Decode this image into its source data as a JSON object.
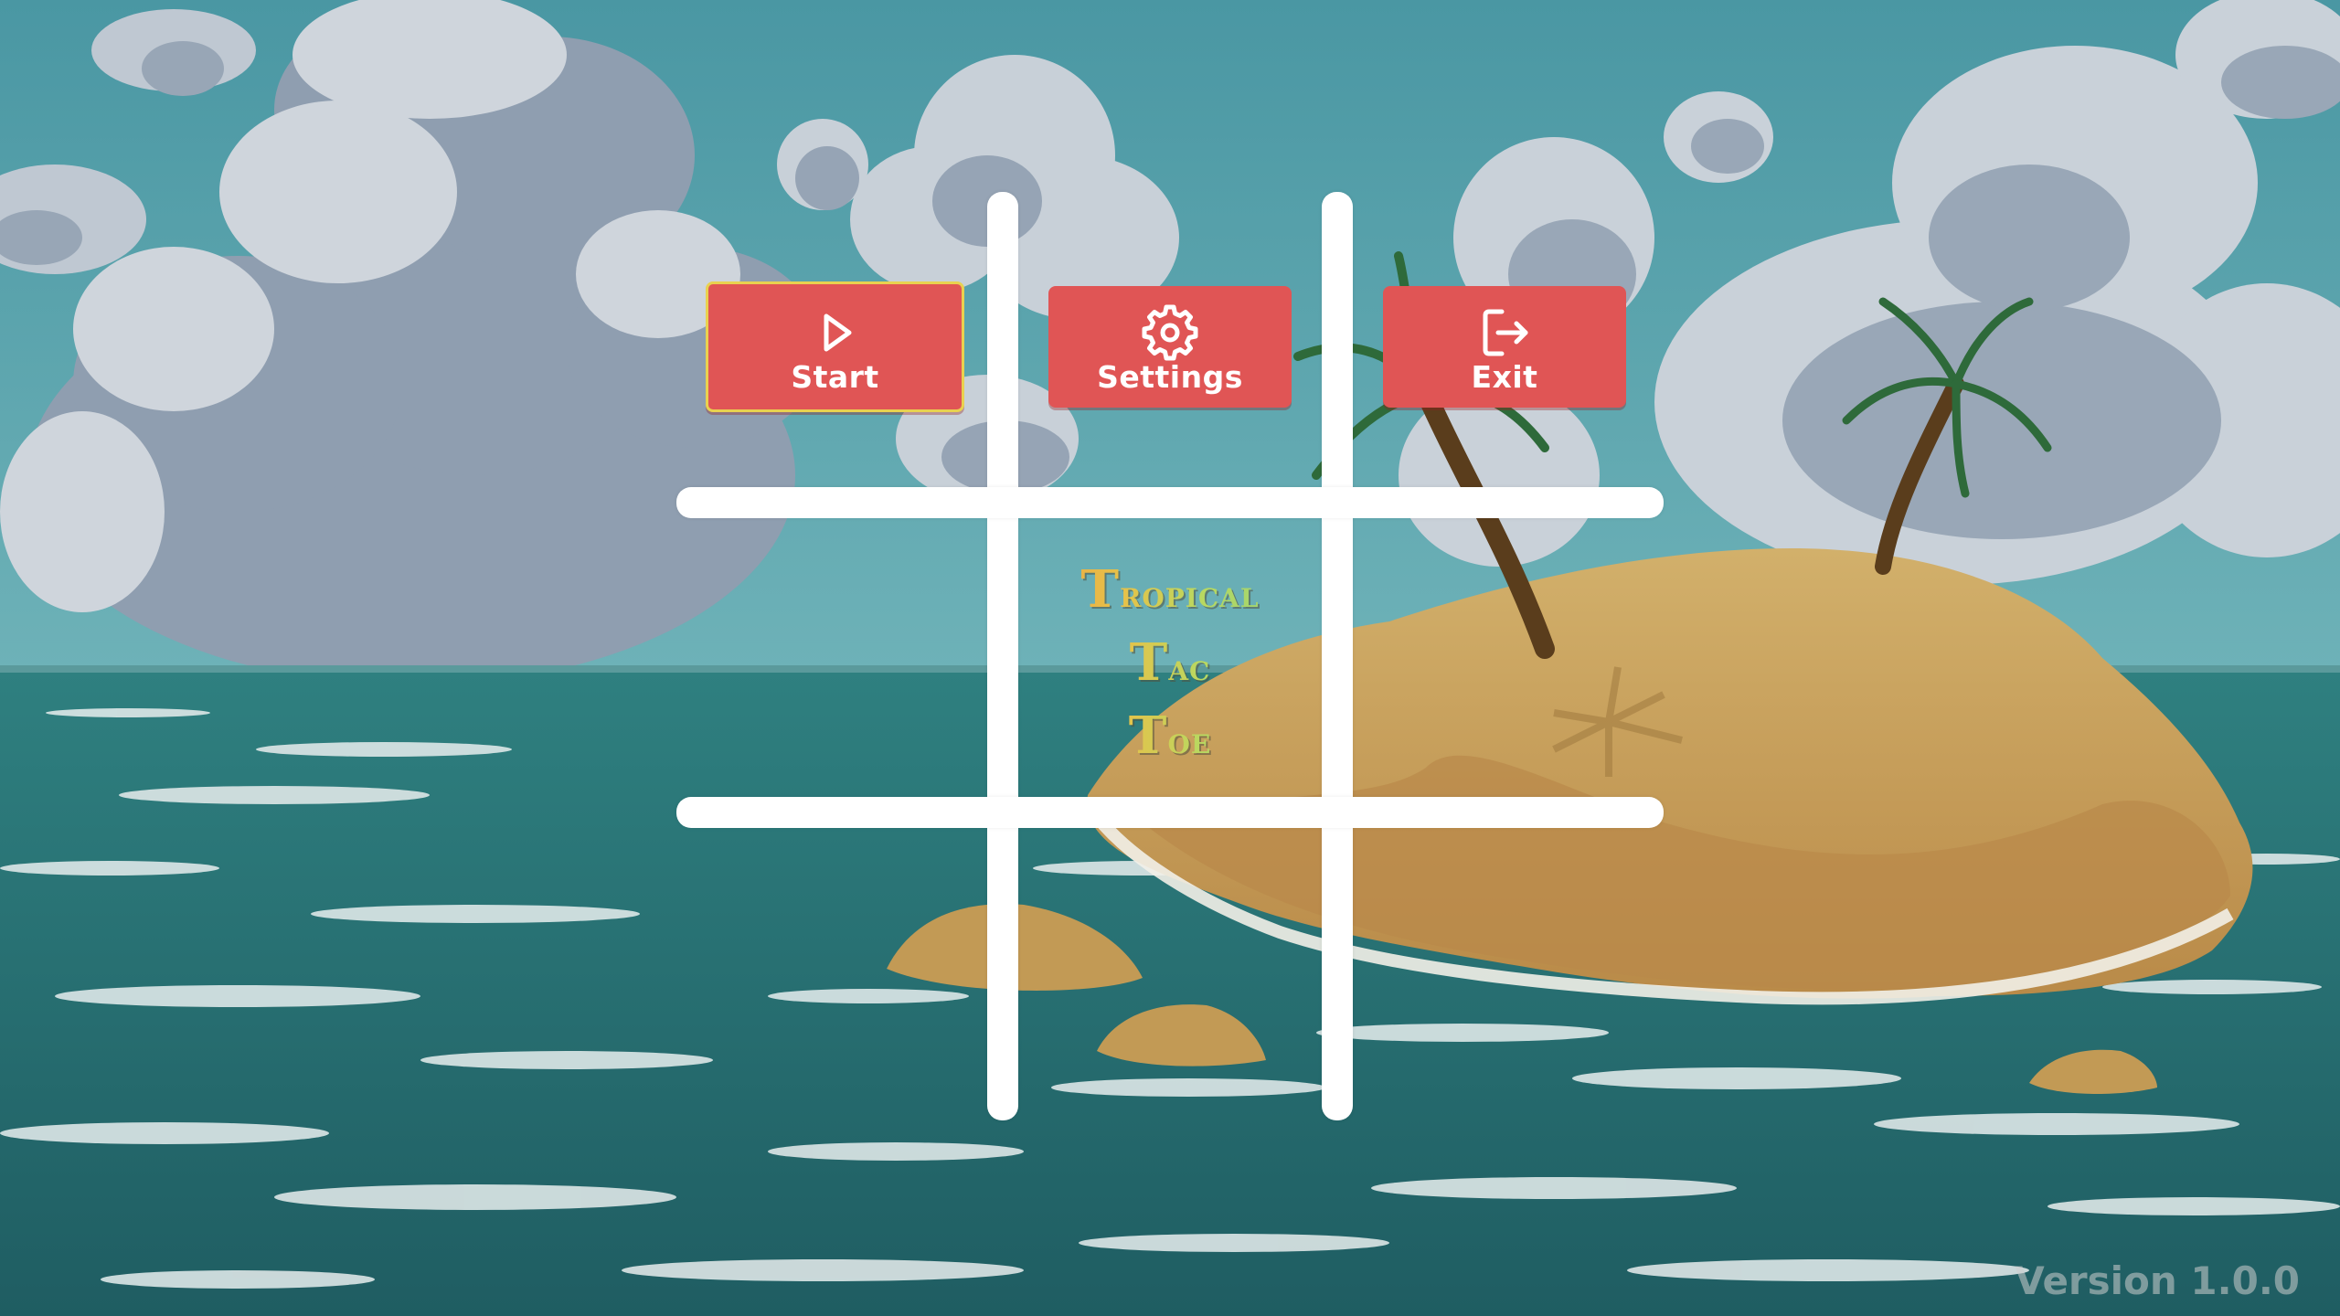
{
  "game": {
    "title_lines": [
      "Tropical",
      "Tac",
      "Toe"
    ],
    "version": "Version 1.0.0"
  },
  "menu": {
    "selected": "start",
    "buttons": [
      {
        "id": "start",
        "label": "Start",
        "icon": "play-icon"
      },
      {
        "id": "settings",
        "label": "Settings",
        "icon": "gear-icon"
      },
      {
        "id": "exit",
        "label": "Exit",
        "icon": "exit-icon"
      }
    ]
  },
  "colors": {
    "button": "#e05555",
    "selected_border": "#e9d14f",
    "grid": "#ffffff",
    "sky": "#4f9aa5",
    "sea": "#2b7474",
    "sand": "#c7a35c"
  }
}
